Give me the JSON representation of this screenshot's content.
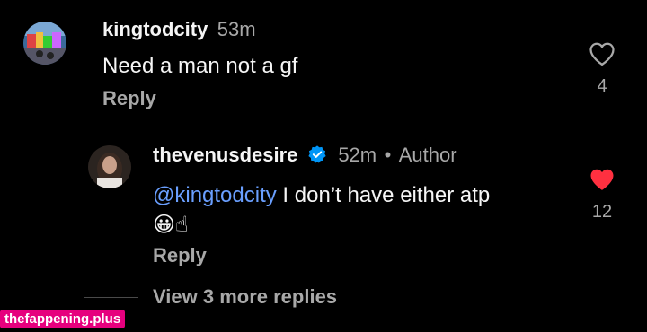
{
  "comments": [
    {
      "username": "kingtodcity",
      "time": "53m",
      "text": "Need a man not a gf",
      "reply_label": "Reply",
      "like_count": "4",
      "liked": false
    },
    {
      "username": "thevenusdesire",
      "time": "52m",
      "separator": "•",
      "author_label": "Author",
      "mention": "@kingtodcity",
      "text": " I don’t have either atp",
      "emoji": "😀☝",
      "reply_label": "Reply",
      "like_count": "12",
      "liked": true
    }
  ],
  "view_more_label": "View 3 more replies",
  "watermark": "thefappening.plus",
  "colors": {
    "background": "#000000",
    "mention": "#6a9fff",
    "like_active": "#ff3040",
    "verified": "#0095f6",
    "watermark_bg": "#e6007e"
  },
  "icons": {
    "heart_outline": "heart-outline-icon",
    "heart_filled": "heart-filled-icon",
    "verified": "verified-badge-icon"
  }
}
